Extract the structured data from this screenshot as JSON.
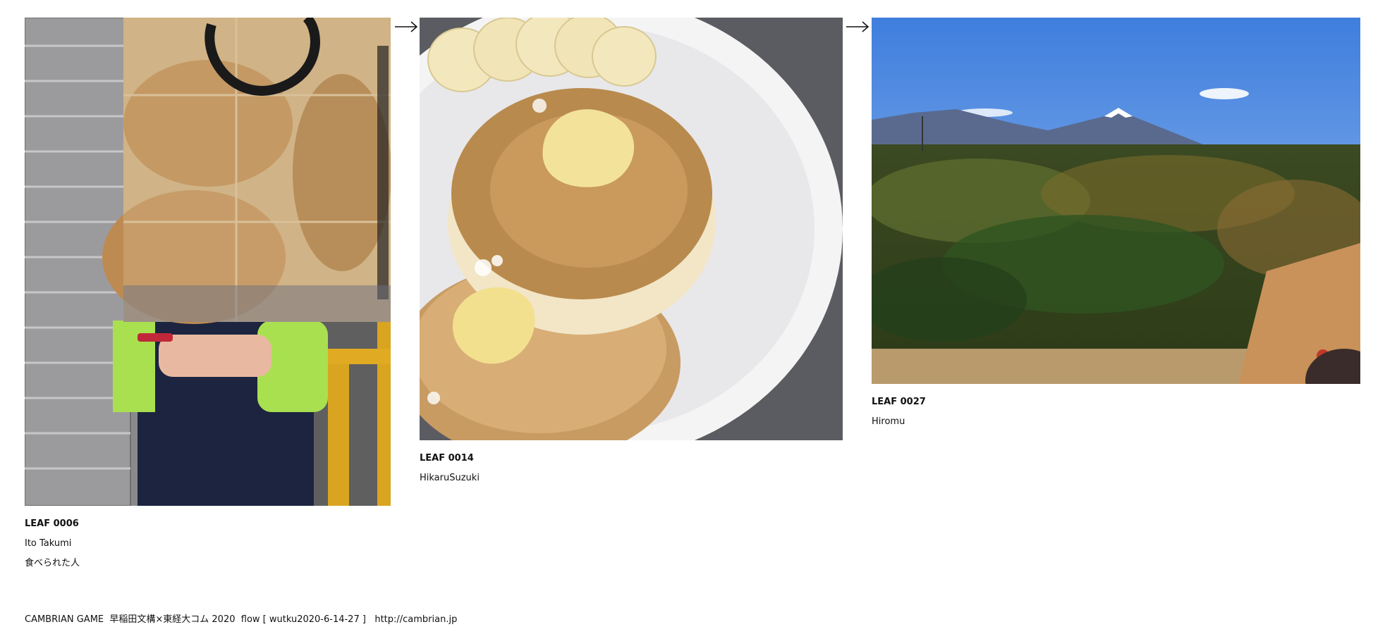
{
  "leaves": [
    {
      "code": "LEAF 0006",
      "author": "Ito Takumi",
      "title": "食べられた人",
      "photo": "taiyaki-banner-photo"
    },
    {
      "code": "LEAF 0014",
      "author": "HikaruSuzuki",
      "photo": "pancake-plate-photo"
    },
    {
      "code": "LEAF 0027",
      "author": "Hiromu",
      "photo": "mount-fuji-forest-photo"
    }
  ],
  "arrows": [
    "arrow-right-icon",
    "arrow-right-icon"
  ],
  "footer": {
    "text": "CAMBRIAN GAME  早稲田文構×東経大コム 2020  flow [ wutku2020-6-14-27 ]",
    "link": "http://cambrian.jp"
  }
}
